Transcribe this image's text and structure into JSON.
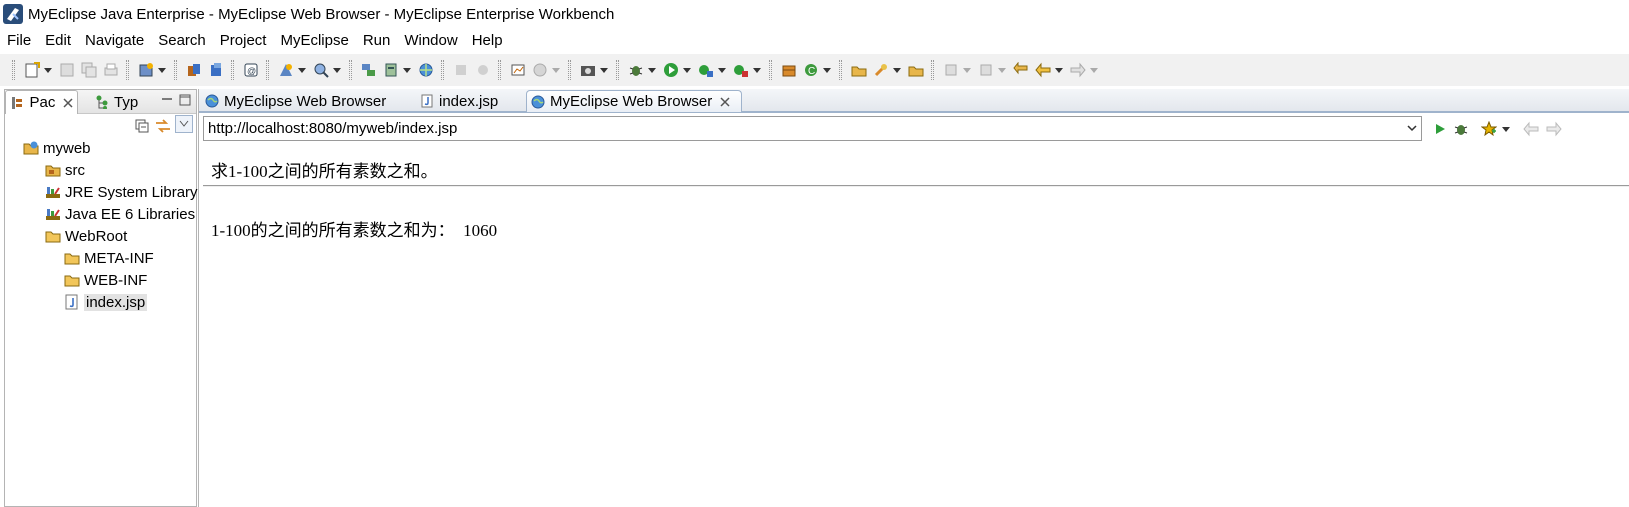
{
  "window": {
    "title": "MyEclipse Java Enterprise - MyEclipse Web Browser - MyEclipse Enterprise Workbench"
  },
  "menu": [
    "File",
    "Edit",
    "Navigate",
    "Search",
    "Project",
    "MyEclipse",
    "Run",
    "Window",
    "Help"
  ],
  "left_panel": {
    "tabs": [
      {
        "label": "Pac",
        "icon": "package-explorer-icon"
      },
      {
        "label": "Typ",
        "icon": "type-hierarchy-icon"
      }
    ],
    "tree": [
      {
        "label": "myweb",
        "icon": "web-project-icon",
        "level": 0
      },
      {
        "label": "src",
        "icon": "source-folder-icon",
        "level": 1
      },
      {
        "label": "JRE System Library",
        "icon": "library-icon",
        "level": 1
      },
      {
        "label": "Java EE 6 Libraries",
        "icon": "library-icon",
        "level": 1
      },
      {
        "label": "WebRoot",
        "icon": "folder-icon",
        "level": 1
      },
      {
        "label": "META-INF",
        "icon": "folder-icon",
        "level": 2
      },
      {
        "label": "WEB-INF",
        "icon": "folder-icon",
        "level": 2
      },
      {
        "label": "index.jsp",
        "icon": "jsp-file-icon",
        "level": 2,
        "selected": true
      }
    ]
  },
  "editor": {
    "tabs": [
      {
        "label": "MyEclipse Web Browser",
        "icon": "globe-icon",
        "active": false
      },
      {
        "label": "index.jsp",
        "icon": "jsp-file-icon",
        "active": false
      },
      {
        "label": "MyEclipse Web Browser",
        "icon": "globe-icon",
        "active": true
      }
    ],
    "url": "http://localhost:8080/myweb/index.jsp",
    "page": {
      "heading": "求1-100之间的所有素数之和。",
      "result_label": "1-100的之间的所有素数之和为：",
      "result_value": "1060"
    }
  },
  "colors": {
    "toolbar_bg": "#f1f1f1",
    "tab_border": "#9fb3cc"
  }
}
